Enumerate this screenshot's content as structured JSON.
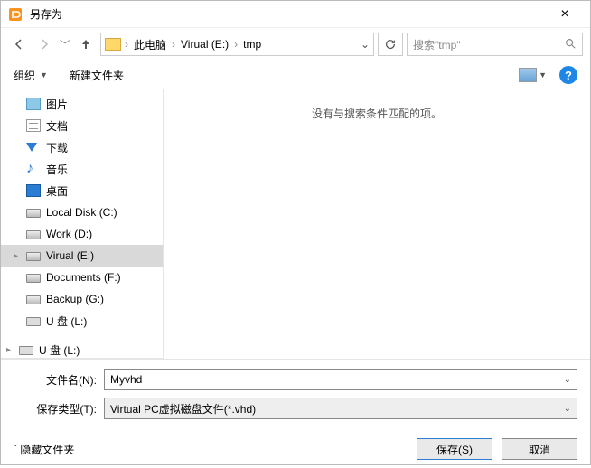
{
  "title": "另存为",
  "breadcrumbs": {
    "pc": "此电脑",
    "drive": "Virual (E:)",
    "folder": "tmp"
  },
  "search_placeholder": "搜索\"tmp\"",
  "toolbar": {
    "organize": "组织",
    "newfolder": "新建文件夹"
  },
  "tree": {
    "pictures": "图片",
    "documents_lib": "文档",
    "downloads": "下载",
    "music": "音乐",
    "desktop": "桌面",
    "local_c": "Local Disk (C:)",
    "work_d": "Work (D:)",
    "virual_e": "Virual (E:)",
    "documents_f": "Documents (F:)",
    "backup_g": "Backup (G:)",
    "u_l1": "U 盘 (L:)",
    "u_l2": "U 盘 (L:)"
  },
  "empty_msg": "没有与搜索条件匹配的项。",
  "filename_label": "文件名(N):",
  "filename_value": "Myvhd",
  "filetype_label": "保存类型(T):",
  "filetype_value": "Virtual PC虚拟磁盘文件(*.vhd)",
  "hide_folders": "隐藏文件夹",
  "save_btn": "保存(S)",
  "cancel_btn": "取消"
}
